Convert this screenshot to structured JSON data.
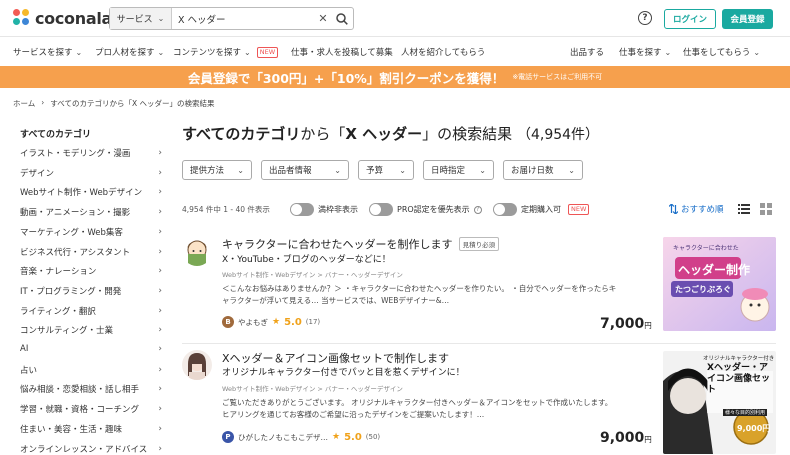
{
  "header": {
    "logo_text": "coconala",
    "search": {
      "service_label": "サービス",
      "value": "X ヘッダー"
    },
    "help_label": "?",
    "login_label": "ログイン",
    "register_label": "会員登録"
  },
  "nav": {
    "items": [
      {
        "label": "サービスを探す",
        "dropdown": true
      },
      {
        "label": "プロ人材を探す",
        "dropdown": true
      },
      {
        "label": "コンテンツを探す",
        "dropdown": true,
        "badge": "NEW"
      },
      {
        "label": "仕事・求人を投稿して募集",
        "dropdown": false
      },
      {
        "label": "人材を紹介してもらう",
        "dropdown": false
      },
      {
        "label": "出品する",
        "dropdown": false
      },
      {
        "label": "仕事を探す",
        "dropdown": true
      },
      {
        "label": "仕事をしてもらう",
        "dropdown": true
      }
    ]
  },
  "banner": {
    "main": "会員登録で「300円」+「10%」割引クーポンを獲得！",
    "sub": "※電話サービスはご利用不可"
  },
  "breadcrumb": {
    "home": "ホーム",
    "separator": "›",
    "current": "すべてのカテゴリから「X ヘッダー」の検索結果"
  },
  "sidebar": {
    "title": "すべてのカテゴリ",
    "items": [
      "イラスト・モデリング・漫画",
      "デザイン",
      "Webサイト制作・Webデザイン",
      "動画・アニメーション・撮影",
      "マーケティング・Web集客",
      "ビジネス代行・アシスタント",
      "音楽・ナレーション",
      "IT・プログラミング・開発",
      "ライティング・翻訳",
      "コンサルティング・士業",
      "AI",
      "占い",
      "悩み相談・恋愛相談・話し相手",
      "学習・就職・資格・コーチング",
      "住まい・美容・生活・趣味",
      "オンラインレッスン・アドバイス"
    ]
  },
  "results": {
    "heading_prefix": "すべてのカテゴリ",
    "heading_mid": "から「",
    "heading_query": "X ヘッダー",
    "heading_suffix": "」の検索結果",
    "heading_count": "（4,954件）",
    "filters": [
      "提供方法",
      "出品者情報",
      "予算",
      "日時指定",
      "お届け日数"
    ],
    "count_text": "4,954 件中 1 - 40 件表示",
    "toggles": [
      {
        "label": "満枠非表示"
      },
      {
        "label": "PRO認定を優先表示",
        "help": "?"
      },
      {
        "label": "定期購入可",
        "badge": "NEW"
      }
    ],
    "sort_label": "おすすめ順",
    "items": [
      {
        "title": "キャラクターに合わせたヘッダーを制作します",
        "tag": "見積り必須",
        "subtitle": "X・YouTube・ブログのヘッダーなどに！",
        "category": "Webサイト制作・Webデザイン > バナー・ヘッダーデザイン",
        "description": "＜こんなお悩みはありませんか？＞ ・キャラクターに合わせたヘッダーを作りたい。 ・自分でヘッダーを作ったらキャラクターが浮いて見える… 当サービスでは、WEBデザイナー&…",
        "rank": "B",
        "seller": "やよもぎ",
        "rating": "5.0",
        "reviews": "(17)",
        "price": "7,000",
        "price_unit": "円",
        "image_text": {
          "top": "キャラクターに合わせた",
          "main": "ヘッダー制作",
          "name": "たつごりぷろぐ"
        }
      },
      {
        "title": "Xヘッダー＆アイコン画像セットで制作します",
        "subtitle": "オリジナルキャラクター付きでパッと目を惹くデザインに！",
        "category": "Webサイト制作・Webデザイン > バナー・ヘッダーデザイン",
        "description": "ご覧いただきありがとうございます。 オリジナルキャラクター付きヘッダー＆アイコンをセットで作成いたします。 ヒアリングを通じてお客様のご希望に沿ったデザインをご提案いたします！…",
        "rank": "P",
        "seller": "ひがしたノもこもこデザ…",
        "rating": "5.0",
        "reviews": "(50)",
        "price": "9,000",
        "price_unit": "円",
        "image_text": {
          "top": "オリジナルキャラクター付き",
          "main": "Xヘッダー・アイコン画像セット",
          "badge": "様々な目的別利用",
          "price": "9,000円"
        }
      }
    ]
  },
  "colors": {
    "accent": "#1aa9a0",
    "banner": "#f6a04d",
    "link": "#1a6fc9",
    "star": "#f0a21a",
    "new": "#e55555"
  }
}
